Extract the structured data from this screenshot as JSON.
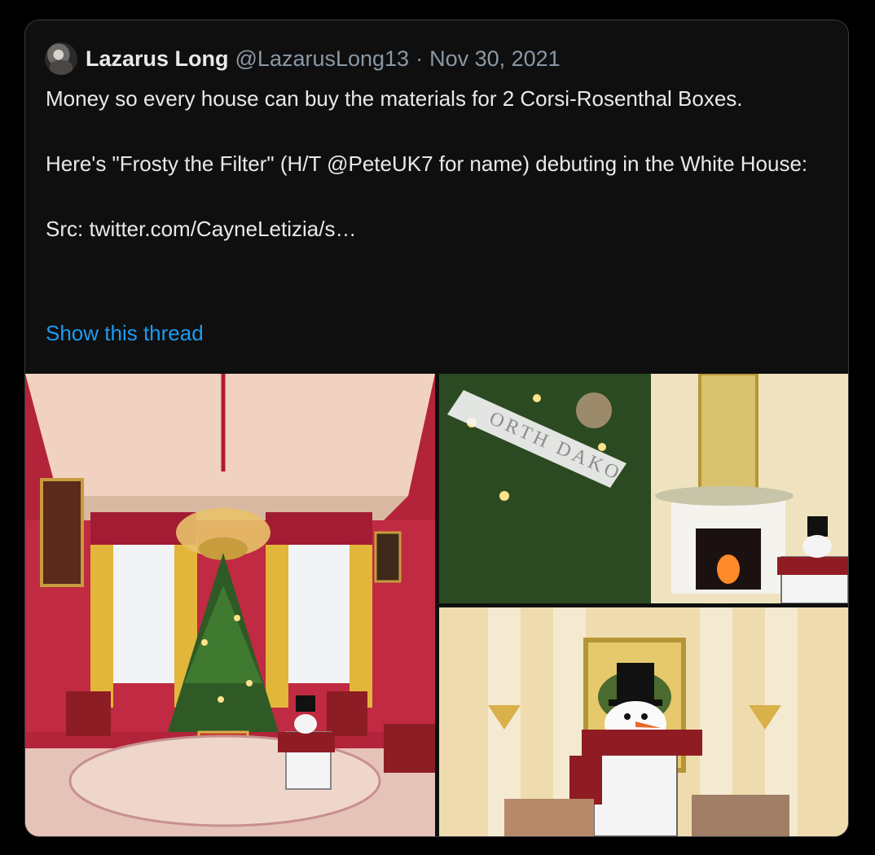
{
  "tweet": {
    "author_name": "Lazarus Long",
    "handle": "@LazarusLong13",
    "separator": "·",
    "date": "Nov 30, 2021",
    "text_line1": "Money so every house can buy the materials for 2 Corsi-Rosenthal Boxes.",
    "text_line2": "Here's \"Frosty the Filter\" (H/T @PeteUK7 for name) debuting in the White House:",
    "text_line3": "Src: twitter.com/CayneLetizia/s…",
    "show_thread": "Show this thread"
  },
  "media": {
    "ornament_text": "ORTH DAKO"
  },
  "colors": {
    "background": "#000000",
    "card": "#0f0f0f",
    "text": "#e7e9ea",
    "muted": "#8b98a5",
    "link": "#1d9bf0"
  },
  "icons": [
    "avatar"
  ]
}
